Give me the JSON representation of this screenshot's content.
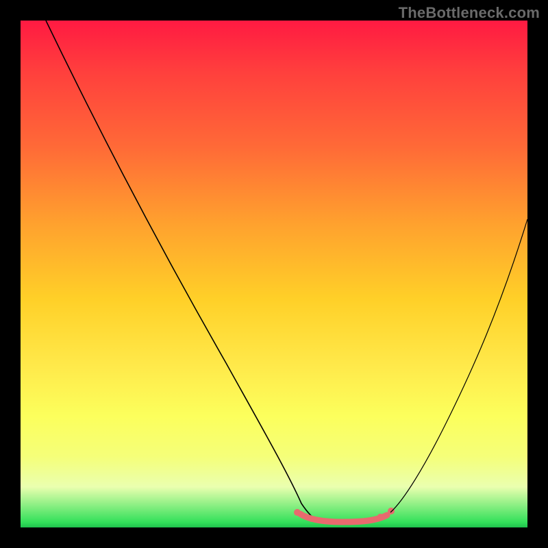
{
  "watermark": "TheBottleneck.com",
  "colors": {
    "background_black": "#000000",
    "gradient_top": "#ff1a42",
    "gradient_mid": "#ffd028",
    "gradient_bottom": "#1fc24d",
    "curve_stroke": "#000000",
    "optimal_stroke": "#e86a6e"
  },
  "chart_data": {
    "type": "line",
    "title": "",
    "xlabel": "",
    "ylabel": "",
    "xlim": [
      0,
      100
    ],
    "ylim": [
      0,
      100
    ],
    "grid": false,
    "legend": false,
    "note": "axes unlabeled; values are fractional positions (0–100) read from pixel geometry",
    "series": [
      {
        "name": "curve-left",
        "x": [
          5,
          10,
          20,
          30,
          40,
          50,
          55,
          58
        ],
        "y": [
          100,
          91,
          73,
          54,
          35,
          15,
          6,
          2
        ]
      },
      {
        "name": "optimal-flat",
        "x": [
          55,
          58,
          62,
          66,
          70,
          73
        ],
        "y": [
          3,
          2,
          1.5,
          1.5,
          2,
          3
        ]
      },
      {
        "name": "curve-right",
        "x": [
          73,
          78,
          84,
          90,
          96,
          100
        ],
        "y": [
          3,
          10,
          23,
          37,
          52,
          62
        ]
      }
    ],
    "optimal_band": {
      "x_range": [
        55,
        73
      ],
      "y_approx": 2,
      "color": "#e86a6e"
    }
  }
}
